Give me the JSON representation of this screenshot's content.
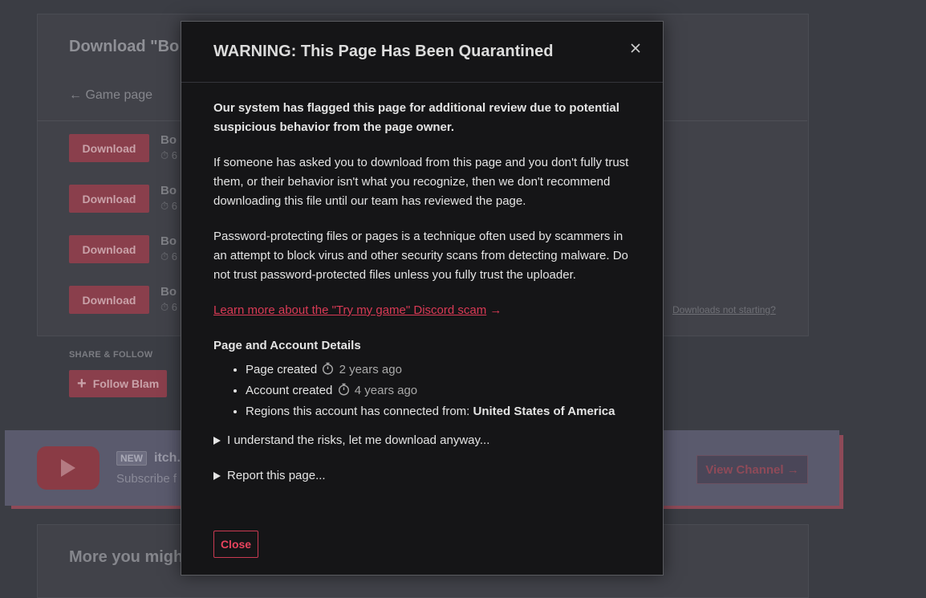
{
  "background": {
    "title": "Download \"Bo",
    "nav_back": "← Game page",
    "nav_second": "",
    "downloads": [
      {
        "button": "Download",
        "name": "Bo",
        "meta": "6"
      },
      {
        "button": "Download",
        "name": "Bo",
        "meta": "6"
      },
      {
        "button": "Download",
        "name": "Bo",
        "meta": "6"
      },
      {
        "button": "Download",
        "name": "Bo",
        "meta": "6"
      }
    ],
    "downloads_not_starting": "Downloads not starting?",
    "share_label": "SHARE & FOLLOW",
    "follow_button": "Follow Blam",
    "promo": {
      "badge": "NEW",
      "title": "itch.",
      "subtitle": "Subscribe f",
      "view_channel": "View Channel →"
    },
    "more_title": "More you migh"
  },
  "modal": {
    "title": "WARNING: This Page Has Been Quarantined",
    "intro": "Our system has flagged this page for additional review due to potential suspicious behavior from the page owner.",
    "paragraph_trust": "If someone has asked you to download from this page and you don't fully trust them, or their behavior isn't what you recognize, then we don't recommend downloading this file until our team has reviewed the page.",
    "paragraph_password": "Password-protecting files or pages is a technique often used by scammers in an attempt to block virus and other security scans from detecting malware. Do not trust password-protected files unless you fully trust the uploader.",
    "learn_more_link": "Learn more about the \"Try my game\" Discord scam",
    "learn_more_arrow": "→",
    "details_heading": "Page and Account Details",
    "details": {
      "page_created_label": "Page created",
      "page_created_value": "2 years ago",
      "account_created_label": "Account created",
      "account_created_value": "4 years ago",
      "regions_label": "Regions this account has connected from:",
      "regions_value": "United States of America"
    },
    "understand_risks": "I understand the risks, let me download anyway...",
    "report_page": "Report this page...",
    "close_button": "Close"
  },
  "colors": {
    "accent": "#d93a55",
    "modal_bg": "#151517",
    "page_bg": "#3b3d44"
  }
}
